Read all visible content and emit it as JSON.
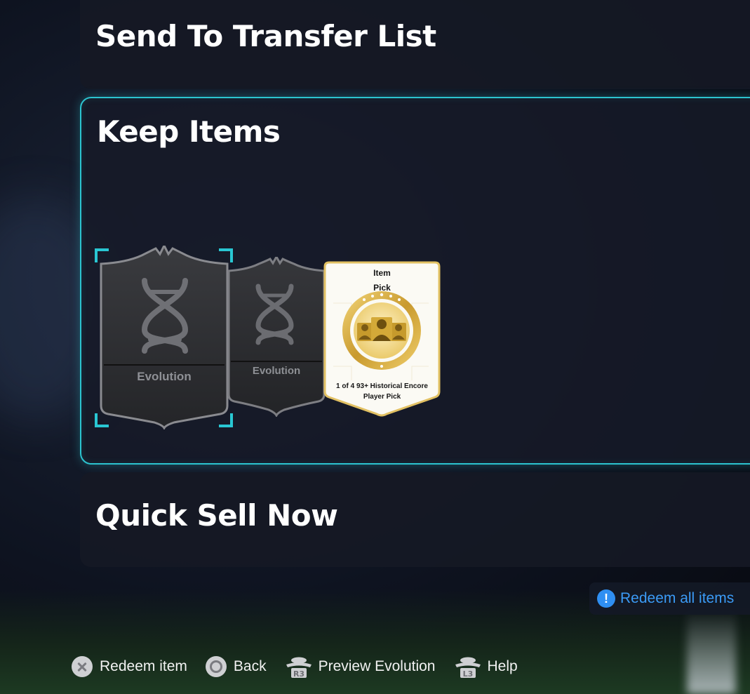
{
  "panels": {
    "send_to_transfer_list": "Send To Transfer List",
    "keep_items": "Keep Items",
    "quick_sell_now": "Quick Sell Now"
  },
  "cards": [
    {
      "type": "evolution",
      "label": "Evolution",
      "icon": "dna-icon",
      "selected": true
    },
    {
      "type": "evolution",
      "label": "Evolution",
      "icon": "dna-icon",
      "selected": false
    },
    {
      "type": "item-pick",
      "title_line1": "Item",
      "title_line2": "Pick",
      "icon": "player-group-icon",
      "description": "1 of 4 93+ Historical Encore Player Pick"
    }
  ],
  "redeem_all": {
    "label": "Redeem all items",
    "icon": "alert-icon"
  },
  "footer": {
    "hints": [
      {
        "button": "cross-button",
        "label": "Redeem item"
      },
      {
        "button": "circle-button",
        "label": "Back"
      },
      {
        "button": "R3",
        "label": "Preview Evolution"
      },
      {
        "button": "L3",
        "label": "Help"
      }
    ]
  },
  "colors": {
    "selection_accent": "#2cc3cf",
    "redeem_link": "#3b9bf6",
    "pick_card_gold": "#d8b24a"
  }
}
